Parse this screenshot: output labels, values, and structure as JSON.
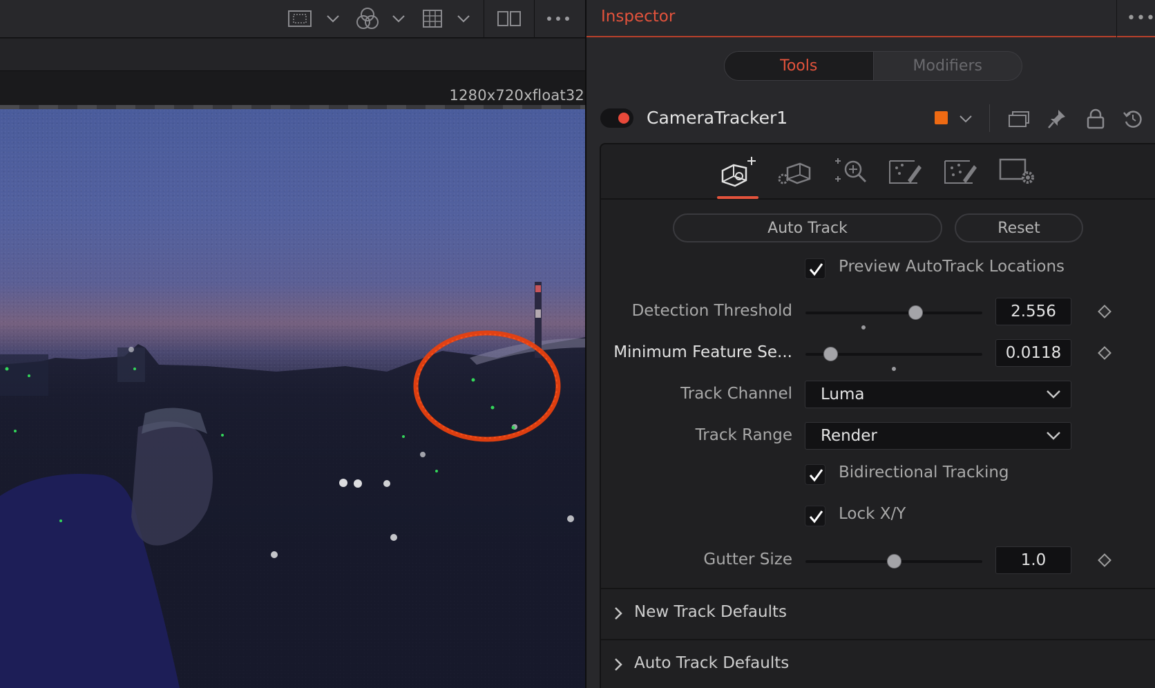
{
  "viewer": {
    "toolbar_icons": [
      "roi-icon",
      "chevron-down-icon",
      "color-channels-icon",
      "chevron-down-icon",
      "grid-icon",
      "chevron-down-icon",
      "split-view-icon",
      "more-icon"
    ],
    "image_info": "1280x720xfloat32",
    "annotation_color": "#e8400f",
    "tracker_point_color": "#33d65a"
  },
  "inspector": {
    "title": "Inspector",
    "title_color": "#e4533c",
    "more_label": "•••",
    "tabs": [
      {
        "label": "Tools",
        "active": true
      },
      {
        "label": "Modifiers",
        "active": false
      }
    ],
    "node": {
      "enabled": true,
      "name": "CameraTracker1",
      "color": "#ee6a13",
      "header_icons": [
        "chevron-down-icon",
        "versions-icon",
        "pin-icon",
        "lock-icon",
        "reset-icon"
      ]
    },
    "icon_tabs": [
      {
        "icon": "track-icon",
        "active": true
      },
      {
        "icon": "camera-settings-icon",
        "active": false
      },
      {
        "icon": "refine-search-icon",
        "active": false
      },
      {
        "icon": "solve-icon",
        "active": false
      },
      {
        "icon": "export-icon",
        "active": false
      },
      {
        "icon": "options-gear-icon",
        "active": false
      }
    ],
    "buttons": {
      "auto_track": "Auto Track",
      "reset": "Reset"
    },
    "preview_autotrack": {
      "label": "Preview AutoTrack Locations",
      "checked": true
    },
    "detection_threshold": {
      "label": "Detection Threshold",
      "value": "2.556",
      "slider_fraction": 0.62,
      "default_fraction": 0.33
    },
    "min_feature_sep": {
      "label": "Minimum Feature Se...",
      "value": "0.0118",
      "slider_fraction": 0.14,
      "default_fraction": 0.5
    },
    "track_channel": {
      "label": "Track Channel",
      "value": "Luma"
    },
    "track_range": {
      "label": "Track Range",
      "value": "Render"
    },
    "bidirectional": {
      "label": "Bidirectional Tracking",
      "checked": true
    },
    "lock_xy": {
      "label": "Lock X/Y",
      "checked": true
    },
    "gutter_size": {
      "label": "Gutter Size",
      "value": "1.0",
      "slider_fraction": 0.5
    },
    "sections": [
      {
        "label": "New Track Defaults",
        "expanded": false
      },
      {
        "label": "Auto Track Defaults",
        "expanded": false
      }
    ]
  }
}
